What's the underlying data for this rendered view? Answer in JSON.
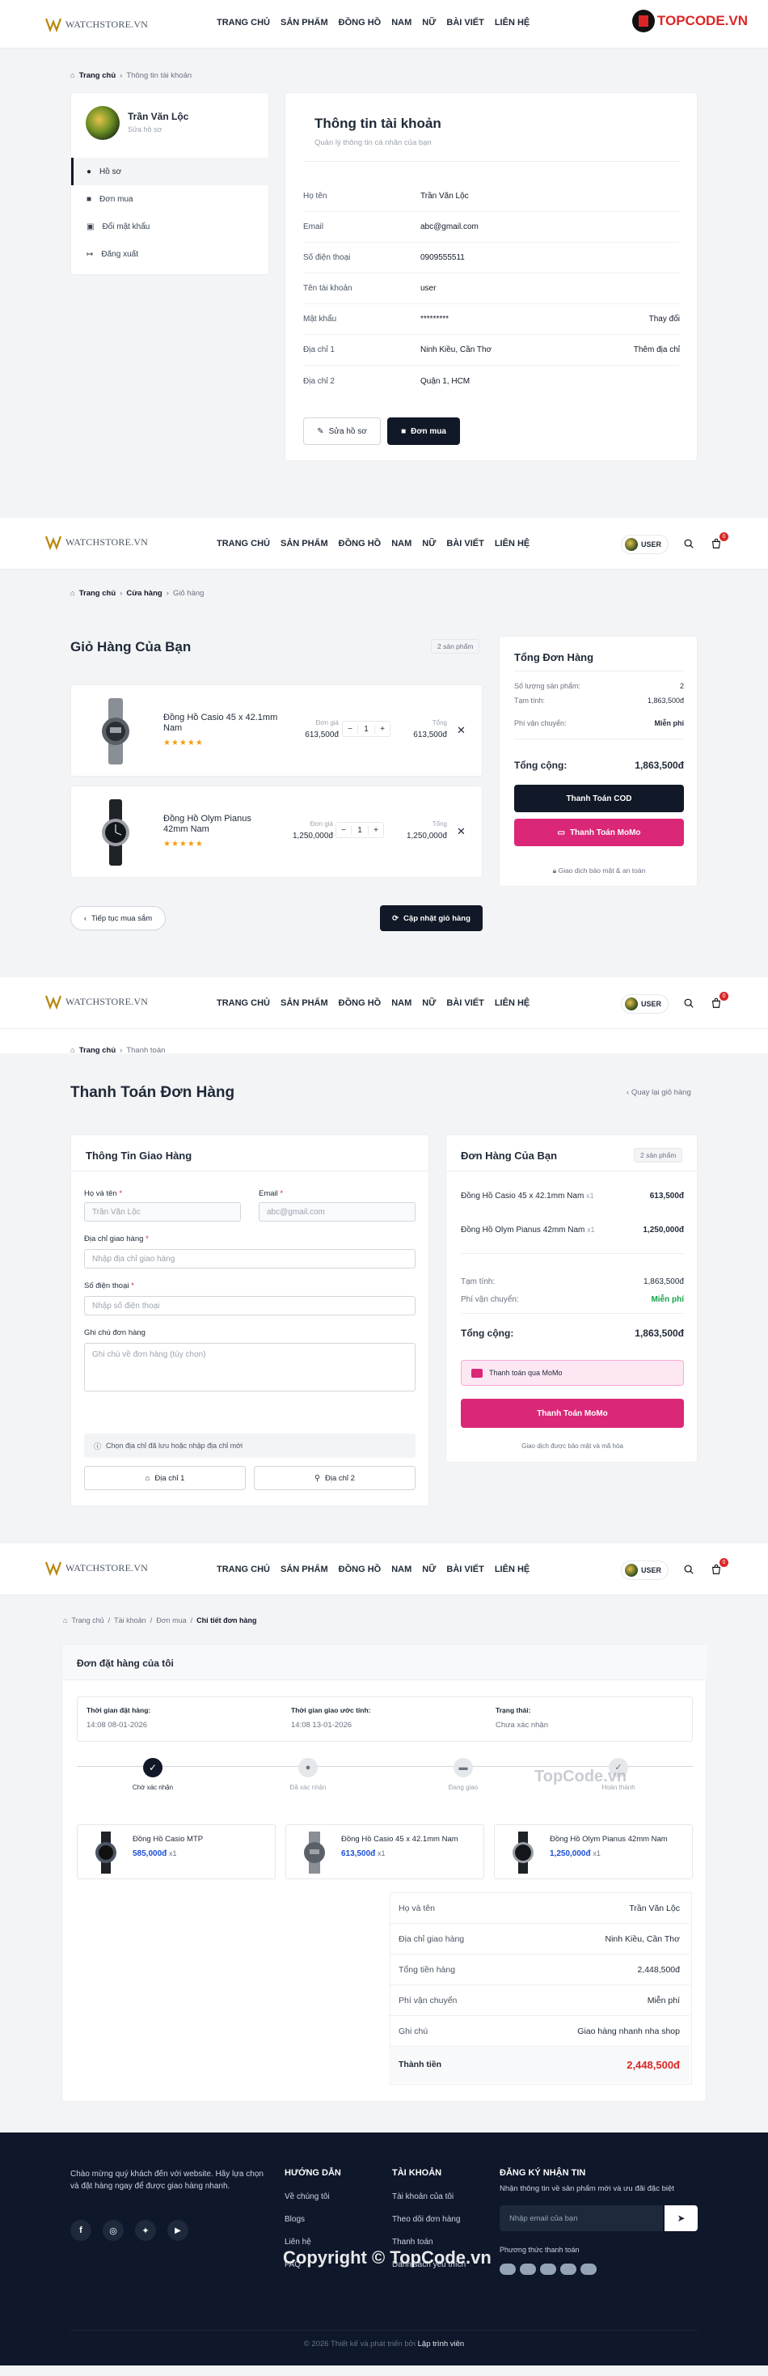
{
  "brand": {
    "logo_text": "WATCHSTORE.VN"
  },
  "nav": [
    "TRANG CHỦ",
    "SẢN PHẨM",
    "ĐỒNG HỒ",
    "NAM",
    "NỮ",
    "BÀI VIẾT",
    "LIÊN HỆ"
  ],
  "topcode_logo": "TOPCODE.VN",
  "user_label": "USER",
  "cart_count": "0",
  "account": {
    "breadcrumb": [
      "Trang chủ",
      "Thông tin tài khoản"
    ],
    "user_name": "Trần Văn Lộc",
    "edit_profile_link": "Sửa hồ sơ",
    "menu": [
      "Hồ sơ",
      "Đơn mua",
      "Đổi mật khẩu",
      "Đăng xuất"
    ],
    "title": "Thông tin tài khoản",
    "subtitle": "Quản lý thông tin cá nhân của bạn",
    "rows": [
      {
        "label": "Họ tên",
        "value": "Trần Văn Lộc",
        "action": ""
      },
      {
        "label": "Email",
        "value": "abc@gmail.com",
        "action": ""
      },
      {
        "label": "Số điện thoại",
        "value": "0909555511",
        "action": ""
      },
      {
        "label": "Tên tài khoản",
        "value": "user",
        "action": ""
      },
      {
        "label": "Mật khẩu",
        "value": "*********",
        "action": "Thay đổi"
      },
      {
        "label": "Địa chỉ 1",
        "value": "Ninh Kiều, Cần Thơ",
        "action": "Thêm địa chỉ"
      },
      {
        "label": "Địa chỉ 2",
        "value": "Quận 1, HCM",
        "action": ""
      }
    ],
    "btn_edit": "Sửa hồ sơ",
    "btn_orders": "Đơn mua"
  },
  "cart": {
    "breadcrumb": [
      "Trang chủ",
      "Cửa hàng",
      "Giỏ hàng"
    ],
    "title": "Giỏ Hàng Của Bạn",
    "count_badge": "2 sản phẩm",
    "unit_label": "Đơn giá",
    "total_label": "Tổng",
    "items": [
      {
        "name": "Đồng Hồ Casio 45 x 42.1mm Nam",
        "stars": "★★★★★",
        "price": "613,500đ",
        "qty": "1",
        "total": "613,500đ"
      },
      {
        "name": "Đồng Hồ Olym Pianus 42mm Nam",
        "stars": "★★★★★",
        "price": "1,250,000đ",
        "qty": "1",
        "total": "1,250,000đ"
      }
    ],
    "continue_btn": "Tiếp tục mua sắm",
    "update_btn": "Cập nhật giỏ hàng",
    "summary": {
      "title": "Tổng Đơn Hàng",
      "qty_label": "Số lượng sản phẩm:",
      "qty_value": "2",
      "subtotal_label": "Tạm tính:",
      "subtotal_value": "1,863,500đ",
      "ship_label": "Phí vận chuyển:",
      "ship_value": "Miễn phí",
      "total_label": "Tổng cộng:",
      "total_value": "1,863,500đ",
      "cod_btn": "Thanh Toán COD",
      "momo_btn": "Thanh Toán MoMo",
      "secure_note": "Giao dịch bảo mật & an toàn"
    }
  },
  "checkout": {
    "breadcrumb": [
      "Trang chủ",
      "Thanh toán"
    ],
    "title": "Thanh Toán Đơn Hàng",
    "back_link": "Quay lại giỏ hàng",
    "shipping_title": "Thông Tin Giao Hàng",
    "name_label": "Họ và tên",
    "name_value": "Trần Văn Lộc",
    "email_label": "Email",
    "email_value": "abc@gmail.com",
    "address_label": "Địa chỉ giao hàng",
    "address_placeholder": "Nhập địa chỉ giao hàng",
    "phone_label": "Số điện thoại",
    "phone_placeholder": "Nhập số điện thoại",
    "note_label": "Ghi chú đơn hàng",
    "note_placeholder": "Ghi chú về đơn hàng (tùy chọn)",
    "saved_note": "Chọn địa chỉ đã lưu hoặc nhập địa chỉ mới",
    "addr1_btn": "Địa chỉ 1",
    "addr2_btn": "Địa chỉ 2",
    "order_title": "Đơn Hàng Của Bạn",
    "order_badge": "2 sản phẩm",
    "lines": [
      {
        "name": "Đồng Hồ Casio 45 x 42.1mm Nam",
        "qty": "x1",
        "price": "613,500đ"
      },
      {
        "name": "Đồng Hồ Olym Pianus 42mm Nam",
        "qty": "x1",
        "price": "1,250,000đ"
      }
    ],
    "subtotal_label": "Tạm tính:",
    "subtotal_value": "1,863,500đ",
    "ship_label": "Phí vận chuyển:",
    "ship_value": "Miễn phí",
    "total_label": "Tổng cộng:",
    "total_value": "1,863,500đ",
    "momo_option": "Thanh toán qua MoMo",
    "momo_btn": "Thanh Toán MoMo",
    "secure_note": "Giao dịch được bảo mật và mã hóa"
  },
  "order": {
    "breadcrumb": [
      "Trang chủ",
      "Tài khoản",
      "Đơn mua",
      "Chi tiết đơn hàng"
    ],
    "title": "Đơn đặt hàng của tôi",
    "placed_label": "Thời gian đặt hàng:",
    "placed_value": "14:08 08-01-2026",
    "eta_label": "Thời gian giao ước tính:",
    "eta_value": "14:08 13-01-2026",
    "status_label": "Trạng thái:",
    "status_value": "Chưa xác nhận",
    "steps": [
      "Chờ xác nhận",
      "Đã xác nhận",
      "Đang giao",
      "Hoàn thành"
    ],
    "watermark": "TopCode.vn",
    "products": [
      {
        "name": "Đồng Hồ Casio MTP",
        "price": "585,000đ",
        "qty": "x1"
      },
      {
        "name": "Đồng Hồ Casio 45 x 42.1mm Nam",
        "price": "613,500đ",
        "qty": "x1"
      },
      {
        "name": "Đồng Hồ Olym Pianus 42mm Nam",
        "price": "1,250,000đ",
        "qty": "x1"
      }
    ],
    "info": [
      {
        "label": "Họ và tên",
        "value": "Trần Văn Lộc"
      },
      {
        "label": "Địa chỉ giao hàng",
        "value": "Ninh Kiều, Cần Thơ"
      },
      {
        "label": "Tổng tiền hàng",
        "value": "2,448,500đ"
      },
      {
        "label": "Phí vận chuyển",
        "value": "Miễn phí"
      },
      {
        "label": "Ghi chú",
        "value": "Giao hàng nhanh nha shop"
      }
    ],
    "grand_label": "Thành tiền",
    "grand_value": "2,448,500đ"
  },
  "footer": {
    "about": "Chào mừng quý khách đến với website. Hãy lựa chọn và đặt hàng ngay để được giao hàng nhanh.",
    "guide_title": "HƯỚNG DẪN",
    "guide_links": [
      "Về chúng tôi",
      "Blogs",
      "Liên hệ",
      "FAQ"
    ],
    "account_title": "TÀI KHOẢN",
    "account_links": [
      "Tài khoản của tôi",
      "Theo dõi đơn hàng",
      "Thanh toán",
      "Danh sách yêu thích"
    ],
    "news_title": "ĐĂNG KÝ NHẬN TIN",
    "news_desc": "Nhận thông tin về sản phẩm mới và ưu đãi đặc biệt",
    "news_placeholder": "Nhập email của bạn",
    "pay_label": "Phương thức thanh toán",
    "copyright_pre": "© 2026 Thiết kế và phát triển bởi",
    "copyright_by": "Lập trình viên",
    "watermark": "Copyright © TopCode.vn"
  }
}
